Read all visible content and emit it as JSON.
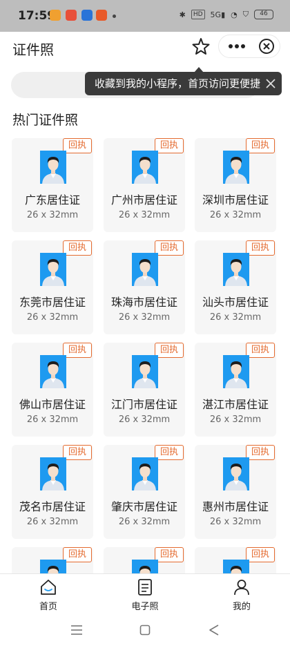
{
  "status_bar": {
    "time": "17:59",
    "app_icon_colors": [
      "#f0a030",
      "#e8503a",
      "#2a74d8",
      "#e85a2a"
    ],
    "hd_label": "HD",
    "signal_label": "5G",
    "battery": "46"
  },
  "header": {
    "title": "证件照"
  },
  "tooltip": {
    "text": "收藏到我的小程序，首页访问更便捷"
  },
  "section_title": "热门证件照",
  "badge_label": "回执",
  "colors": {
    "accent": "#e46a2e",
    "photo_bg": "#1e9af0"
  },
  "cards": [
    {
      "name": "广东居住证",
      "size": "26 x 32mm"
    },
    {
      "name": "广州市居住证",
      "size": "26 x 32mm"
    },
    {
      "name": "深圳市居住证",
      "size": "26 x 32mm"
    },
    {
      "name": "东莞市居住证",
      "size": "26 x 32mm"
    },
    {
      "name": "珠海市居住证",
      "size": "26 x 32mm"
    },
    {
      "name": "汕头市居住证",
      "size": "26 x 32mm"
    },
    {
      "name": "佛山市居住证",
      "size": "26 x 32mm"
    },
    {
      "name": "江门市居住证",
      "size": "26 x 32mm"
    },
    {
      "name": "湛江市居住证",
      "size": "26 x 32mm"
    },
    {
      "name": "茂名市居住证",
      "size": "26 x 32mm"
    },
    {
      "name": "肇庆市居住证",
      "size": "26 x 32mm"
    },
    {
      "name": "惠州市居住证",
      "size": "26 x 32mm"
    },
    {
      "name": "",
      "size": ""
    },
    {
      "name": "",
      "size": ""
    },
    {
      "name": "",
      "size": ""
    }
  ],
  "tabbar": {
    "items": [
      {
        "label": "首页",
        "icon": "home-icon"
      },
      {
        "label": "电子照",
        "icon": "document-icon"
      },
      {
        "label": "我的",
        "icon": "user-icon"
      }
    ]
  }
}
